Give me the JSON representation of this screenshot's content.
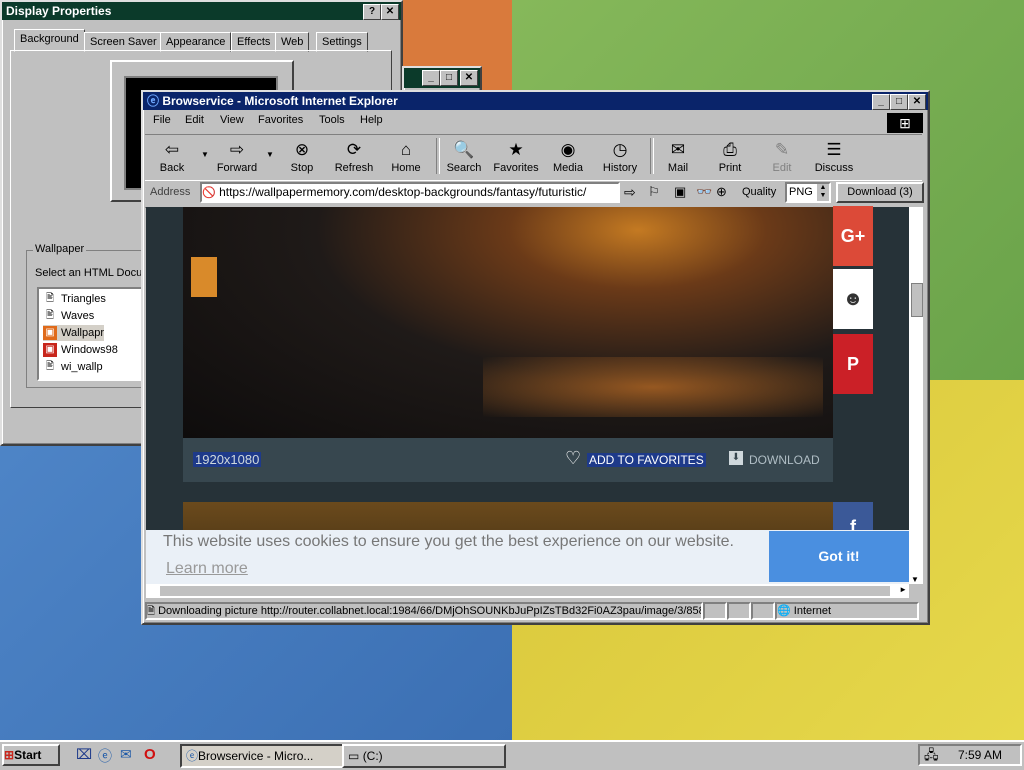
{
  "display_props": {
    "title": "Display Properties",
    "help_btn": "?",
    "close_btn": "✕",
    "tabs": [
      "Background",
      "Screen Saver",
      "Appearance",
      "Effects",
      "Web",
      "Settings"
    ],
    "wallpaper_group": "Wallpaper",
    "select_label": "Select an HTML Docu",
    "wallpaper_items": [
      "Triangles",
      "Waves",
      "Wallpapr",
      "Windows98",
      "wi_wallp"
    ]
  },
  "bg_window": {
    "min": "_",
    "max": "□",
    "close": "✕"
  },
  "ie": {
    "title": "Browservice - Microsoft Internet Explorer",
    "controls": {
      "min": "_",
      "max": "□",
      "close": "✕"
    },
    "menu": [
      "File",
      "Edit",
      "View",
      "Favorites",
      "Tools",
      "Help"
    ],
    "toolbar": [
      "Back",
      "Forward",
      "Stop",
      "Refresh",
      "Home",
      "Search",
      "Favorites",
      "Media",
      "History",
      "Mail",
      "Print",
      "Edit",
      "Discuss"
    ],
    "address_label": "Address",
    "url": "https://wallpapermemory.com/desktop-backgrounds/fantasy/futuristic/",
    "quality_label": "Quality",
    "quality_value": "PNG",
    "download_btn": "Download (3)",
    "status_text": "Downloading picture http://router.collabnet.local:1984/66/DMjOhSOUNKbJuPpIZsTBd32Fi0AZ3pau/image/3/858",
    "zone": "Internet"
  },
  "page": {
    "resolution": "1920x1080",
    "add_favorites": "ADD TO FAVORITES",
    "download": "DOWNLOAD",
    "social": [
      "G+",
      "reddit",
      "P",
      "f"
    ],
    "cookie_text": "This website uses cookies to ensure you get the best experience on our website.",
    "learn_more": "Learn more",
    "got_it": "Got it!"
  },
  "taskbar": {
    "start": "Start",
    "tasks": [
      "Browservice - Micro...",
      "(C:)"
    ],
    "clock": "7:59 AM"
  },
  "colors": {
    "accent": "#4a8fe0",
    "gplus": "#dc4a38",
    "pinterest": "#cb2027",
    "title_active": "#0a246a"
  }
}
